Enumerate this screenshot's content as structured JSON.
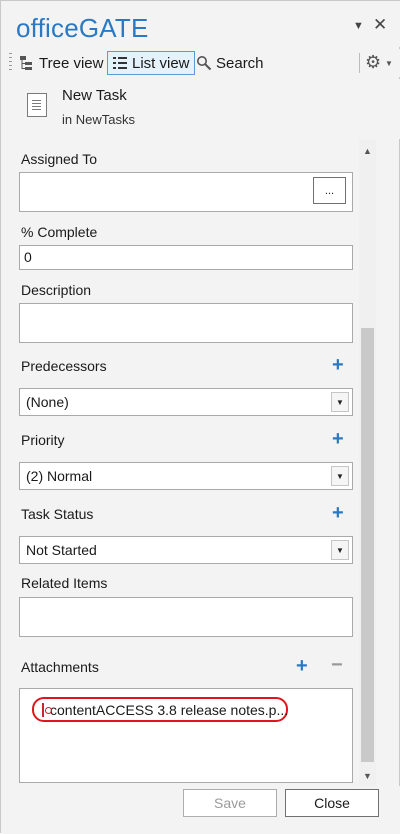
{
  "app": {
    "title": "officeGATE"
  },
  "window_controls": {
    "dropdown_glyph": "▼",
    "close_glyph": "✕"
  },
  "toolbar": {
    "tree_view_label": "Tree view",
    "list_view_label": "List view",
    "search_label": "Search",
    "active_view": "List view"
  },
  "item": {
    "name": "New Task",
    "location": "in NewTasks"
  },
  "form": {
    "assigned_to": {
      "label": "Assigned To",
      "value": "",
      "button_label": "..."
    },
    "percent_complete": {
      "label": "% Complete",
      "value": "0"
    },
    "description": {
      "label": "Description",
      "value": ""
    },
    "predecessors": {
      "label": "Predecessors",
      "value": "(None)",
      "add_glyph": "+"
    },
    "priority": {
      "label": "Priority",
      "value": "(2) Normal",
      "add_glyph": "+"
    },
    "task_status": {
      "label": "Task Status",
      "value": "Not Started",
      "add_glyph": "+"
    },
    "related_items": {
      "label": "Related Items",
      "value": ""
    },
    "attachments": {
      "label": "Attachments",
      "add_glyph": "+",
      "remove_glyph": "−",
      "items": [
        "contentACCESS 3.8 release notes.p..."
      ]
    }
  },
  "footer": {
    "save_label": "Save",
    "close_label": "Close",
    "save_enabled": false
  },
  "colors": {
    "accent": "#2b79c2",
    "highlight": "#e0151c",
    "panel_bg": "#f3f3f3"
  },
  "icons": [
    "tree-view-icon",
    "list-view-icon",
    "search-icon",
    "gear-icon",
    "document-icon",
    "pdf-icon"
  ]
}
